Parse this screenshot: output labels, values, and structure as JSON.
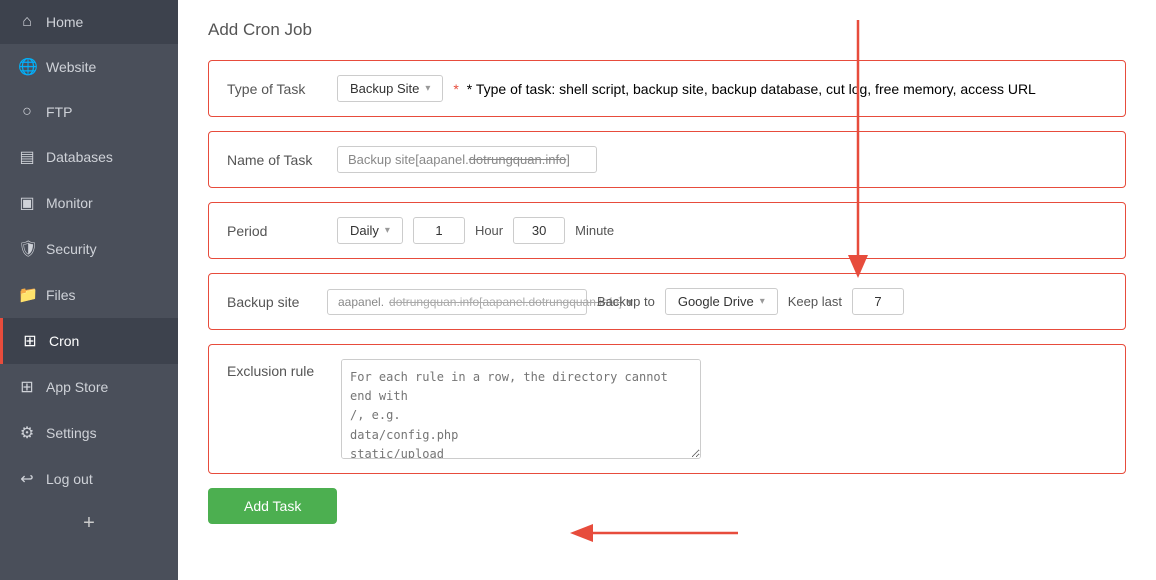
{
  "sidebar": {
    "items": [
      {
        "id": "home",
        "label": "Home",
        "icon": "⌂"
      },
      {
        "id": "website",
        "label": "Website",
        "icon": "🌐"
      },
      {
        "id": "ftp",
        "label": "FTP",
        "icon": "⊙"
      },
      {
        "id": "databases",
        "label": "Databases",
        "icon": "🗄"
      },
      {
        "id": "monitor",
        "label": "Monitor",
        "icon": "📊"
      },
      {
        "id": "security",
        "label": "Security",
        "icon": "🛡"
      },
      {
        "id": "files",
        "label": "Files",
        "icon": "📁"
      },
      {
        "id": "cron",
        "label": "Cron",
        "icon": "⊞",
        "active": true
      },
      {
        "id": "app-store",
        "label": "App Store",
        "icon": "⊞"
      },
      {
        "id": "settings",
        "label": "Settings",
        "icon": "⚙"
      },
      {
        "id": "log-out",
        "label": "Log out",
        "icon": "⬡"
      }
    ],
    "add_label": "+"
  },
  "page": {
    "title": "Add Cron Job"
  },
  "form": {
    "type_of_task_label": "Type of Task",
    "type_of_task_value": "Backup Site",
    "type_of_task_hint": "* Type of task: shell script, backup site, backup database, cut log, free memory, access URL",
    "name_of_task_label": "Name of Task",
    "name_of_task_value": "Backup site[aapanel.",
    "name_of_task_strikethrough": "dotrungquan.info",
    "name_of_task_suffix": "]",
    "period_label": "Period",
    "period_value": "Daily",
    "period_hour_value": "1",
    "period_hour_label": "Hour",
    "period_minute_value": "30",
    "period_minute_label": "Minute",
    "backup_site_label": "Backup site",
    "backup_site_value": "aapanel.",
    "backup_site_strikethrough": "dotrungquan.info[aapanel.dotrungquan.info]",
    "backup_to_label": "Backup to",
    "backup_to_value": "Google Drive",
    "keep_last_label": "Keep last",
    "keep_last_value": "7",
    "exclusion_rule_label": "Exclusion rule",
    "exclusion_rule_placeholder": "For each rule in a row, the directory cannot end with\n/, e.g.\ndata/config.php\nstatic/upload\n*.log",
    "add_task_btn_label": "Add Task"
  }
}
